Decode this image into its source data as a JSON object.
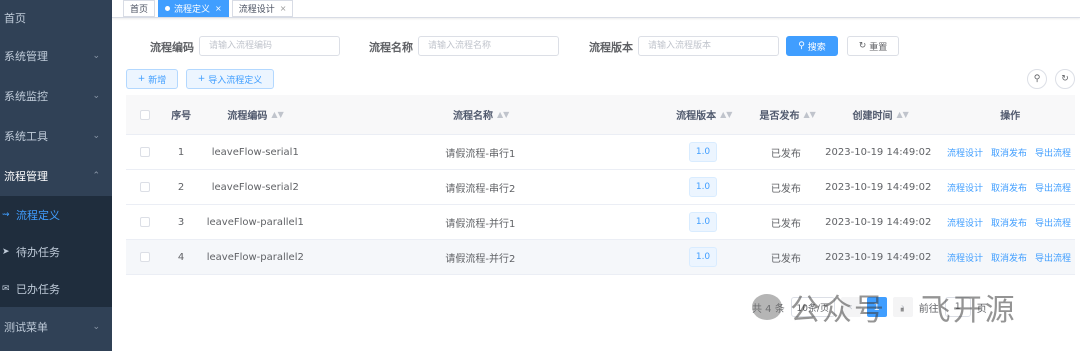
{
  "sidebar": {
    "items": [
      {
        "label": "首页"
      },
      {
        "label": "系统管理"
      },
      {
        "label": "系统监控"
      },
      {
        "label": "系统工具"
      },
      {
        "label": "流程管理"
      }
    ],
    "subitems": [
      {
        "label": "流程定义"
      },
      {
        "label": "待办任务"
      },
      {
        "label": "已办任务"
      }
    ],
    "bottom_item": {
      "label": "测试菜单"
    }
  },
  "tags": [
    {
      "label": "首页"
    },
    {
      "label": "流程定义"
    },
    {
      "label": "流程设计"
    }
  ],
  "search": {
    "code_label": "流程编码",
    "code_placeholder": "请输入流程编码",
    "name_label": "流程名称",
    "name_placeholder": "请输入流程名称",
    "version_label": "流程版本",
    "version_placeholder": "请输入流程版本",
    "search_btn": "搜索",
    "reset_btn": "重置"
  },
  "toolbar": {
    "add_btn": "新增",
    "import_btn": "导入流程定义"
  },
  "table": {
    "headers": {
      "index": "序号",
      "code": "流程编码",
      "name": "流程名称",
      "version": "流程版本",
      "published": "是否发布",
      "created": "创建时间",
      "actions": "操作"
    },
    "rows": [
      {
        "index": "1",
        "code": "leaveFlow-serial1",
        "name": "请假流程-串行1",
        "version": "1.0",
        "published": "已发布",
        "created": "2023-10-19 14:49:02"
      },
      {
        "index": "2",
        "code": "leaveFlow-serial2",
        "name": "请假流程-串行2",
        "version": "1.0",
        "published": "已发布",
        "created": "2023-10-19 14:49:02"
      },
      {
        "index": "3",
        "code": "leaveFlow-parallel1",
        "name": "请假流程-并行1",
        "version": "1.0",
        "published": "已发布",
        "created": "2023-10-19 14:49:02"
      },
      {
        "index": "4",
        "code": "leaveFlow-parallel2",
        "name": "请假流程-并行2",
        "version": "1.0",
        "published": "已发布",
        "created": "2023-10-19 14:49:02"
      }
    ],
    "actions": {
      "design": "流程设计",
      "unpublish": "取消发布",
      "export": "导出流程"
    }
  },
  "pagination": {
    "total": "共 4 条",
    "page_size": "10条/页",
    "current_page": "1",
    "goto_label": "前往",
    "goto_value": "1",
    "page_suffix": "页"
  },
  "watermark": {
    "text": "公众号 · 飞开源"
  },
  "colors": {
    "sidebar_bg": "#304156",
    "sidebar_sub_bg": "#1f2d3d",
    "primary": "#409eff"
  }
}
